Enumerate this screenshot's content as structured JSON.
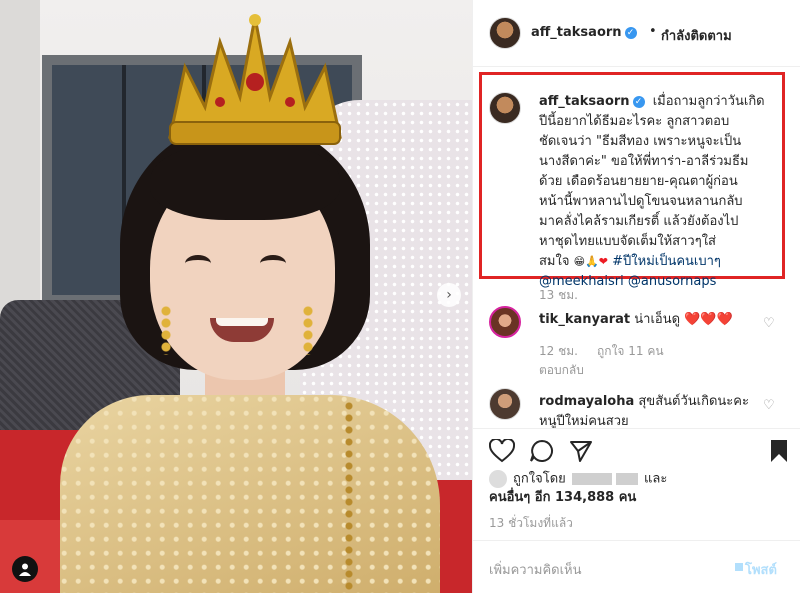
{
  "post": {
    "username": "aff_taksaorn",
    "follow_status": "กำลังติดตาม",
    "dot": "•",
    "caption": {
      "username": "aff_taksaorn",
      "text_lines": [
        "เมื่อถามลูกว่าวันเกิด",
        "ปีนี้อยากได้ธีมอะไรคะ ลูกสาวตอบ",
        "ชัดเจนว่า \"ธีมสีทอง เพราะหนูจะเป็น",
        "นางสีดาค่ะ\" ขอให้พี่ทาร่า-อาลีร่วมธีม",
        "ด้วย เดือดร้อนยายยาย-คุณตาผู้ก่อน",
        "หน้านี้พาหลานไปดูโขนจนหลานกลับ",
        "มาคลั่งไคล้รามเกียรติ์ แล้วยังต้องไป",
        "หาชุดไทยแบบจัดเต็มให้สาวๆใส่"
      ],
      "last_line_prefix": "สมใจ",
      "hashtag": "#ปีใหม่เป็นคนเบาๆ",
      "mentions": "@meekhaisri @anusornaps",
      "time": "13 ชม."
    },
    "comments": [
      {
        "username": "tik_kanyarat",
        "text": "น่าเอ็นดู",
        "hearts": "❤️❤️❤️",
        "time": "12 ชม.",
        "likes": "ถูกใจ 11 คน",
        "reply": "ตอบกลับ"
      },
      {
        "username": "rodmayaloha",
        "text": "สุขสันต์วันเกิดนะคะหนูปีใหม่คนสวย"
      }
    ],
    "likes": {
      "prefix": "ถูกใจโดย",
      "and": "และ",
      "others": "คนอื่นๆ อีก 134,888 คน"
    },
    "time_ago": "13 ชั่วโมงที่แล้ว",
    "add_comment_placeholder": "เพิ่มความคิดเห็น",
    "post_button": "โพสต์"
  },
  "icons": {
    "verified": "verified-badge-icon",
    "like": "heart-outline-icon",
    "comment": "comment-icon",
    "share": "share-icon",
    "save": "bookmark-icon",
    "tag": "user-tag-icon",
    "next": "chevron-right-icon"
  },
  "colors": {
    "highlight_border": "#e02424",
    "verified": "#3897f0",
    "link": "#003569",
    "meta": "#999999"
  }
}
